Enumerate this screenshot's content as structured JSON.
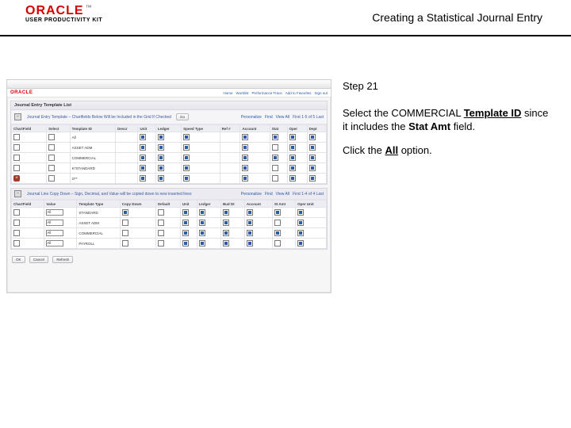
{
  "brand": {
    "wordmark": "ORACLE",
    "tm": "™",
    "subline": "USER PRODUCTIVITY KIT"
  },
  "doc_title": "Creating a Statistical Journal Entry",
  "step_label": "Step 21",
  "instruction": {
    "line1_pre": "Select the COMMERCIAL ",
    "line1_bold_u": "Template ID",
    "line1_post": " since it includes the ",
    "line1_bold2": "Stat Amt",
    "line1_end": " field.",
    "line2_pre": "Click the ",
    "line2_bold_u": "All",
    "line2_post": " option."
  },
  "app": {
    "brand": "ORACLE",
    "nav": [
      "Home",
      "Worklist",
      "Performance Trace",
      "Add to Favorites",
      "Sign out"
    ],
    "panel1": {
      "title": "Journal Entry Template List",
      "sub_left": "Journal Entry Template – Chartfields Below Will be Included in the Grid If Checked",
      "sub_right": [
        "Personalize",
        "Find",
        "View All",
        "First 1-5 of 5 Last"
      ],
      "go": "Go",
      "cols": [
        "ChartField",
        "Select",
        "Template ID",
        "Descr",
        "Unit",
        "Ledger",
        "Speed Type",
        "Ref #",
        "Account",
        "Stat",
        "Oper",
        "Dept"
      ],
      "rows": [
        {
          "cf": "",
          "sel": false,
          "tid": "All",
          "descr": "",
          "unit": "Y",
          "ledger": "Y",
          "st": "Y",
          "acct": "Y",
          "stat": "Y",
          "oper": "Y",
          "dept": "Y"
        },
        {
          "cf": "",
          "sel": false,
          "tid": "ASSET ADM",
          "descr": "",
          "unit": "Y",
          "ledger": "Y",
          "st": "Y",
          "acct": "Y",
          "stat": "",
          "oper": "Y",
          "dept": "Y"
        },
        {
          "cf": "",
          "sel": false,
          "tid": "COMMERCIAL",
          "descr": "",
          "unit": "Y",
          "ledger": "Y",
          "st": "Y",
          "acct": "Y",
          "stat": "Y",
          "oper": "Y",
          "dept": "Y"
        },
        {
          "cf": "",
          "sel": false,
          "tid": "K*STANDARD",
          "descr": "",
          "unit": "Y",
          "ledger": "Y",
          "st": "Y",
          "acct": "Y",
          "stat": "",
          "oper": "Y",
          "dept": "Y"
        },
        {
          "cf": "+",
          "sel": false,
          "tid": "O**",
          "descr": "",
          "unit": "Y",
          "ledger": "Y",
          "st": "Y",
          "acct": "Y",
          "stat": "",
          "oper": "Y",
          "dept": "Y"
        }
      ]
    },
    "panel2": {
      "title": "Journal Line Copy Down – Sign, Decimal, and Value will be copied down to new inserted lines",
      "sub_right": [
        "Personalize",
        "Find",
        "View All",
        "First 1-4 of 4 Last"
      ],
      "cols": [
        "ChartField",
        "Value",
        "Template Type",
        "Copy Down",
        "Default",
        "Unit",
        "Ledger",
        "Bud Dt",
        "Account",
        "St Amt",
        "Oper Unit"
      ],
      "rows": [
        {
          "cf": "",
          "val": "",
          "tt": "All",
          "tty": "STANDARD",
          "cd": "Y",
          "u": "Y",
          "l": "Y",
          "b": "Y",
          "a": "Y",
          "s": "Y",
          "o": "Y"
        },
        {
          "cf": "",
          "val": "",
          "tt": "All",
          "tty": "ASSET ADM",
          "cd": "",
          "u": "Y",
          "l": "Y",
          "b": "Y",
          "a": "Y",
          "s": "",
          "o": "Y"
        },
        {
          "cf": "",
          "val": "",
          "tt": "All",
          "tty": "COMMERCIAL",
          "cd": "",
          "u": "Y",
          "l": "Y",
          "b": "Y",
          "a": "Y",
          "s": "Y",
          "o": "Y"
        },
        {
          "cf": "",
          "val": "",
          "tt": "All",
          "tty": "PAYROLL",
          "cd": "",
          "u": "Y",
          "l": "Y",
          "b": "Y",
          "a": "Y",
          "s": "",
          "o": "Y"
        }
      ]
    },
    "buttons": {
      "ok": "OK",
      "cancel": "Cancel",
      "refresh": "Refresh"
    }
  }
}
